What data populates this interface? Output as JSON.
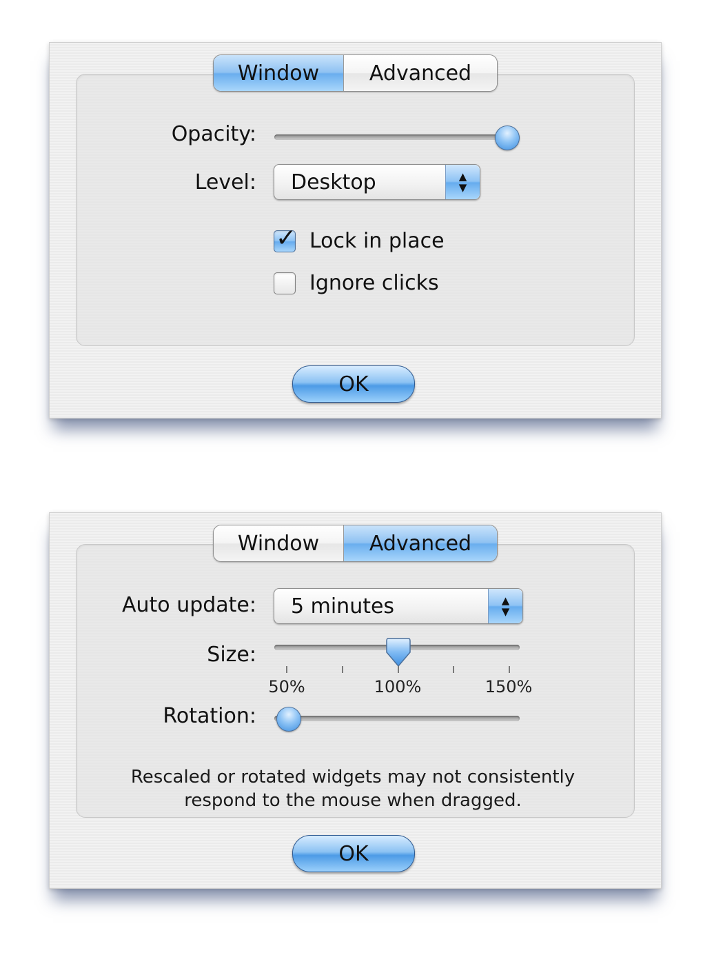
{
  "window_panel": {
    "tabs": [
      {
        "label": "Window",
        "active": true
      },
      {
        "label": "Advanced",
        "active": false
      }
    ],
    "opacity_label": "Opacity:",
    "opacity_value": 1.0,
    "level_label": "Level:",
    "level_value": "Desktop",
    "lock_label": "Lock in place",
    "lock_checked": true,
    "ignore_label": "Ignore clicks",
    "ignore_checked": false,
    "ok_label": "OK"
  },
  "advanced_panel": {
    "tabs": [
      {
        "label": "Window",
        "active": false
      },
      {
        "label": "Advanced",
        "active": true
      }
    ],
    "auto_update_label": "Auto update:",
    "auto_update_value": "5 minutes",
    "size_label": "Size:",
    "size_value": "100%",
    "size_ticks": [
      "50%",
      "100%",
      "150%"
    ],
    "rotation_label": "Rotation:",
    "rotation_value": 0,
    "note_line1": "Rescaled or rotated widgets may not consistently",
    "note_line2": "respond to the mouse when dragged.",
    "ok_label": "OK"
  },
  "colors": {
    "accent_blue": "#6aaeee",
    "shadow_blue": "#28406e"
  }
}
